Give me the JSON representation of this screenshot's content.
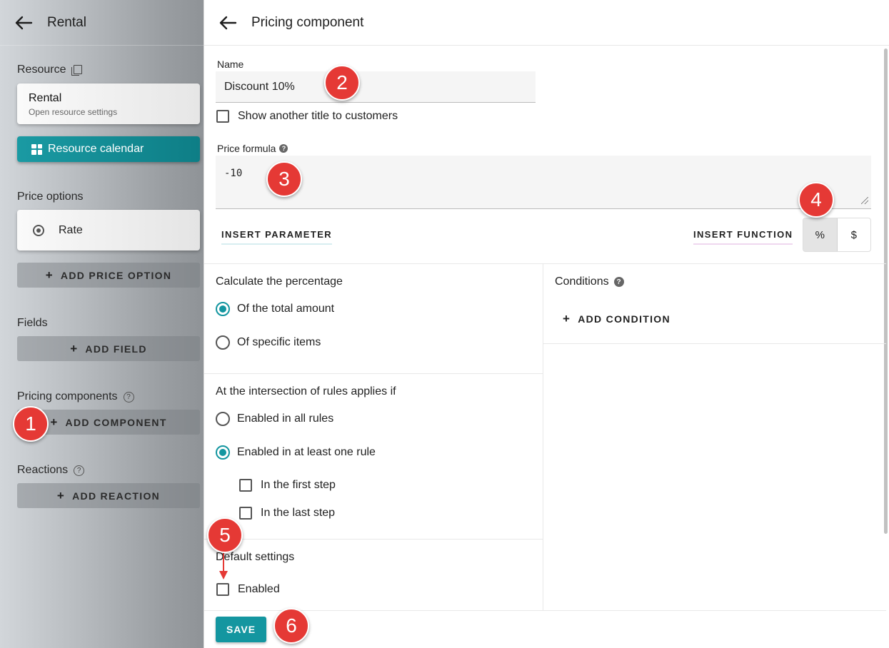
{
  "sidebar": {
    "title": "Rental",
    "resource_label": "Resource",
    "resource_card": {
      "title": "Rental",
      "subtitle": "Open resource settings"
    },
    "calendar_button": "Resource calendar",
    "price_options_label": "Price options",
    "rate_label": "Rate",
    "add_price_option": "ADD PRICE OPTION",
    "fields_label": "Fields",
    "add_field": "ADD FIELD",
    "pricing_components_label": "Pricing components",
    "add_component": "ADD COMPONENT",
    "reactions_label": "Reactions",
    "add_reaction": "ADD REACTION"
  },
  "main": {
    "title": "Pricing component",
    "name_label": "Name",
    "name_value": "Discount 10%",
    "show_title_label": "Show another title to customers",
    "price_formula_label": "Price formula",
    "formula_value": "-10",
    "insert_parameter": "INSERT PARAMETER",
    "insert_function": "INSERT FUNCTION",
    "toggle": {
      "percent": "%",
      "dollar": "$",
      "selected": "%"
    },
    "calculate_title": "Calculate the percentage",
    "calc_options": [
      "Of the total amount",
      "Of specific items"
    ],
    "calc_selected": "Of the total amount",
    "conditions_title": "Conditions",
    "add_condition": "ADD CONDITION",
    "intersection_title": "At the intersection of rules applies if",
    "intersection_options": [
      "Enabled in all rules",
      "Enabled in at least one rule"
    ],
    "intersection_selected": "Enabled in at least one rule",
    "first_step": "In the first step",
    "last_step": "In the last step",
    "default_settings_title": "Default settings",
    "enabled_label": "Enabled",
    "save": "SAVE"
  },
  "annotations": [
    "1",
    "2",
    "3",
    "4",
    "5",
    "6"
  ],
  "colors": {
    "accent": "#1496a0",
    "badge": "#e53935"
  }
}
